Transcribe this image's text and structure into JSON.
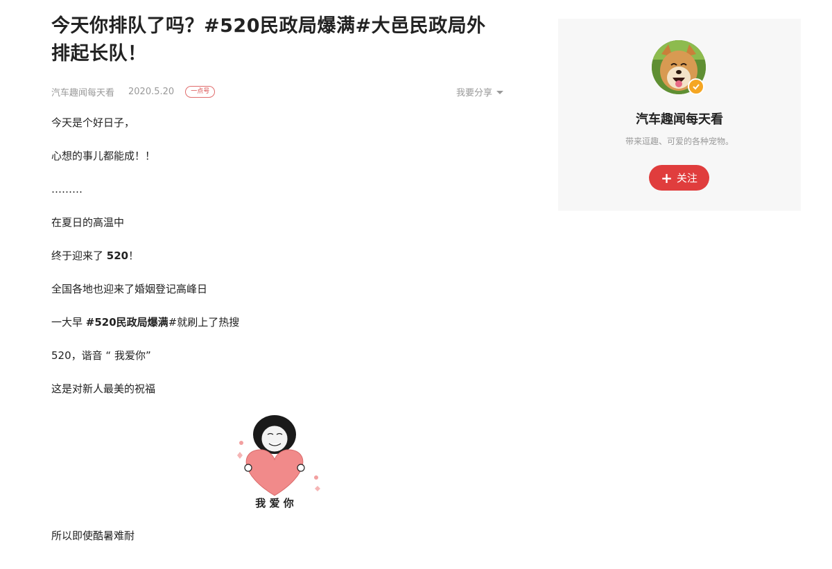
{
  "article": {
    "title": "今天你排队了吗？#520民政局爆满#大邑民政局外排起长队！",
    "author": "汽车趣闻每天看",
    "date": "2020.5.20",
    "badge": "一点号",
    "share_label": "我要分享",
    "paragraphs": [
      "今天是个好日子，",
      "心想的事儿都能成！！",
      "………",
      "在夏日的高温中",
      {
        "prefix": "终于迎来了 ",
        "bold": "520",
        "suffix": "！"
      },
      "全国各地也迎来了婚姻登记高峰日",
      {
        "prefix": "一大早 ",
        "bold": "#520民政局爆满",
        "suffix": "#就刷上了热搜"
      },
      "520，谐音 “ 我爱你”",
      "这是对新人最美的祝福"
    ],
    "sticker_text": "我 爱 你",
    "after_image": "所以即使酷暑难耐"
  },
  "author_card": {
    "name": "汽车趣闻每天看",
    "description": "带来逗趣、可爱的各种宠物。",
    "follow_label": "关注"
  },
  "colors": {
    "accent": "#e03d3d",
    "badge": "#d84a4a",
    "verified": "#f5a623",
    "card_bg": "#f7f7f7"
  }
}
